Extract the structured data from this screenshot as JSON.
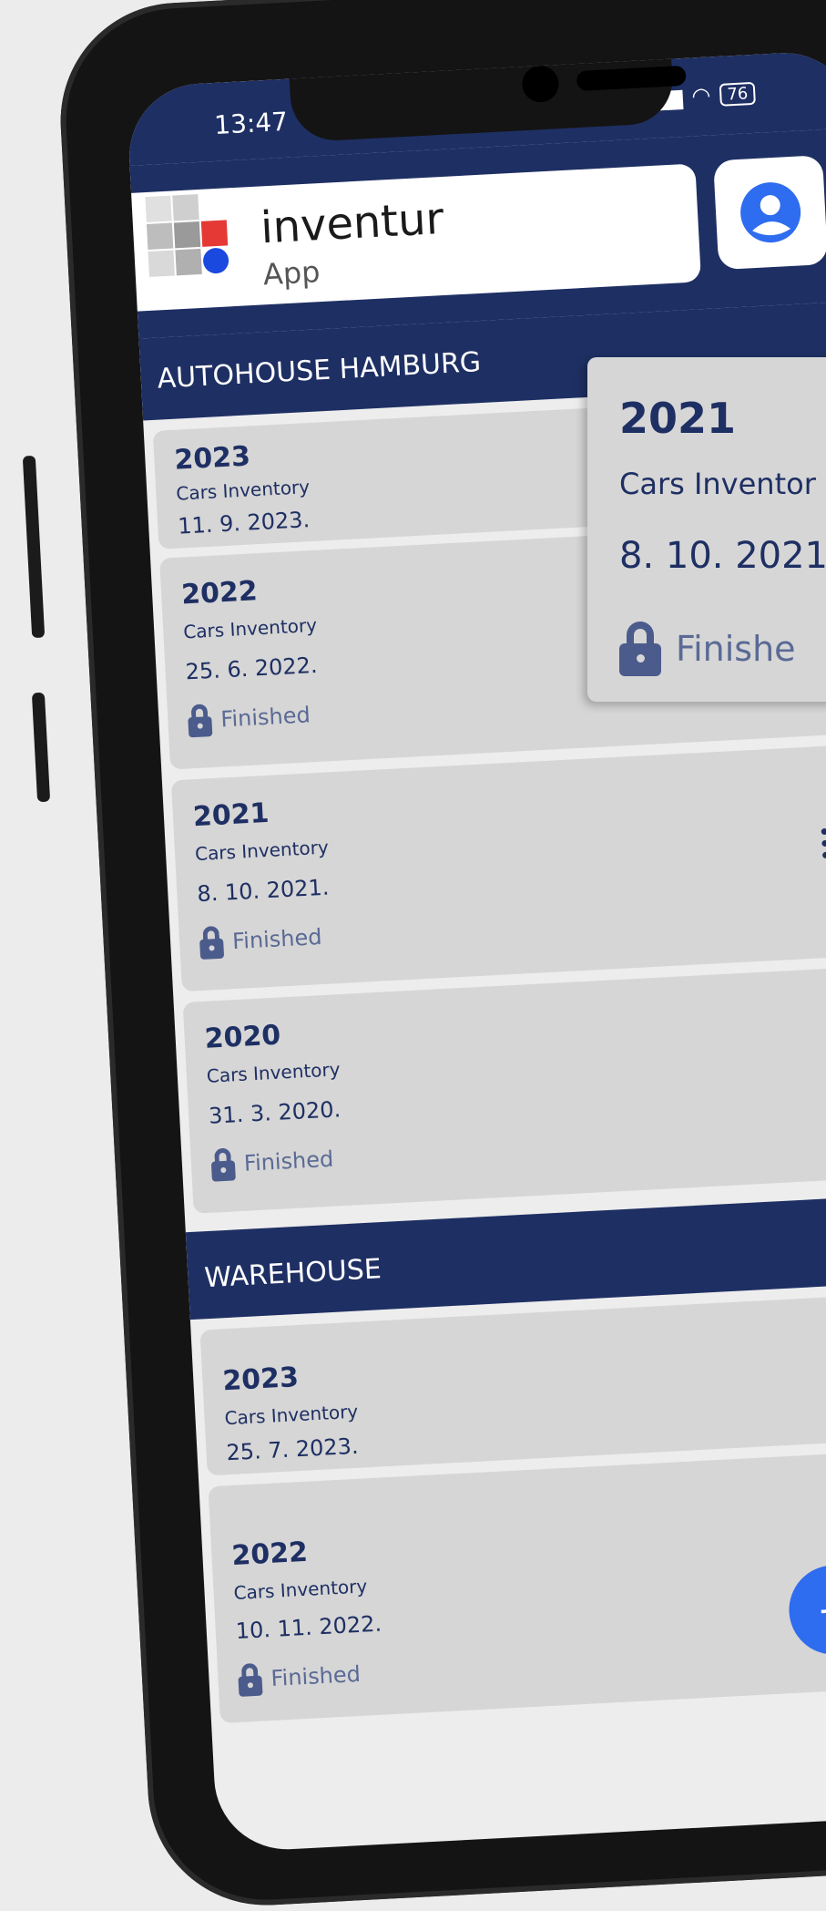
{
  "status_bar": {
    "time": "13:47",
    "battery": "76"
  },
  "header": {
    "logo_title": "inventur",
    "logo_sub": "App"
  },
  "sections": [
    {
      "title": "AUTOHOUSE HAMBURG",
      "cards": [
        {
          "year": "2023",
          "type": "Cars Inventory",
          "date": "11. 9. 2023.",
          "status": ""
        },
        {
          "year": "2022",
          "type": "Cars Inventory",
          "date": "25. 6. 2022.",
          "status": "Finished"
        },
        {
          "year": "2021",
          "type": "Cars Inventory",
          "date": "8. 10. 2021.",
          "status": "Finished"
        },
        {
          "year": "2020",
          "type": "Cars Inventory",
          "date": "31. 3. 2020.",
          "status": "Finished"
        }
      ]
    },
    {
      "title": "WAREHOUSE",
      "cards": [
        {
          "year": "2023",
          "type": "Cars Inventory",
          "date": "25. 7. 2023.",
          "status": ""
        },
        {
          "year": "2022",
          "type": "Cars Inventory",
          "date": "10. 11. 2022.",
          "status": "Finished"
        }
      ]
    }
  ],
  "popup": {
    "year": "2021",
    "type": "Cars Inventor",
    "date": "8. 10. 2021.",
    "status": "Finishe"
  },
  "fab": {
    "label": "+"
  },
  "colors": {
    "primary": "#1e2f63",
    "card": "#d6d6d6",
    "fab": "#2e6cf0"
  }
}
